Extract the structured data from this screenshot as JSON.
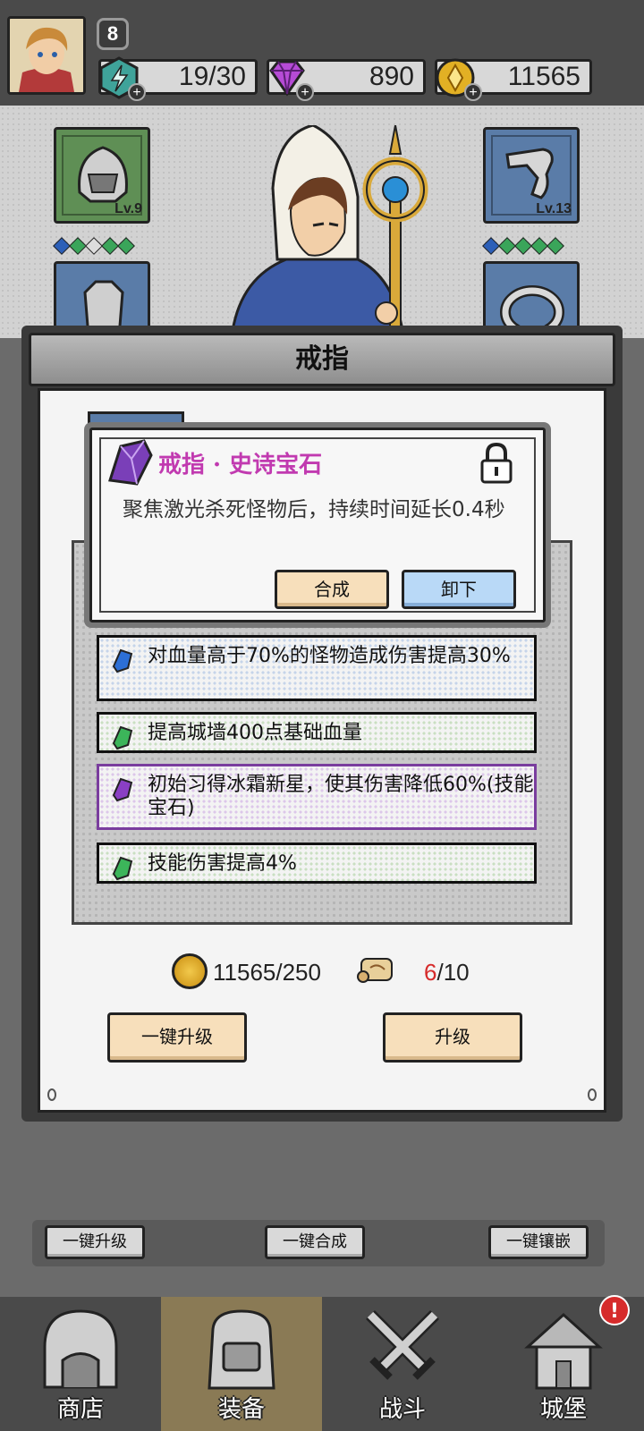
{
  "player": {
    "level": "8",
    "energy": "19/30",
    "gems": "890",
    "gold": "11565"
  },
  "equipment": {
    "helmet_level": "Lv.9",
    "gloves_level": "Lv.13"
  },
  "panel": {
    "title": "戒指"
  },
  "popup": {
    "title": "戒指 · 史诗宝石",
    "description": "聚焦激光杀死怪物后，持续时间延长0.4秒",
    "merge_label": "合成",
    "unequip_label": "卸下"
  },
  "gems": [
    {
      "text": "对血量高于70%的怪物造成伤害提高30%",
      "color": "blue"
    },
    {
      "text": "提高城墙400点基础血量",
      "color": "green"
    },
    {
      "text": "初始习得冰霜新星，使其伤害降低60%(技能宝石)",
      "color": "purple"
    },
    {
      "text": "技能伤害提高4%",
      "color": "green"
    }
  ],
  "upgrade": {
    "gold_cost": "11565/250",
    "scroll_have": "6",
    "scroll_need": "/10",
    "one_click_upgrade_label": "一键升级",
    "upgrade_label": "升级"
  },
  "bottom_actions": {
    "upgrade_all": "一键升级",
    "merge_all": "一键合成",
    "inlay_all": "一键镶嵌"
  },
  "nav": [
    {
      "label": "商店",
      "icon": "shop-icon",
      "active": false
    },
    {
      "label": "装备",
      "icon": "backpack-icon",
      "active": true
    },
    {
      "label": "战斗",
      "icon": "swords-icon",
      "active": false
    },
    {
      "label": "城堡",
      "icon": "castle-icon",
      "active": false
    }
  ],
  "nav_alert": "!",
  "colors": {
    "epic_purple": "#c13ab0",
    "scroll_red": "#d62b2b"
  }
}
